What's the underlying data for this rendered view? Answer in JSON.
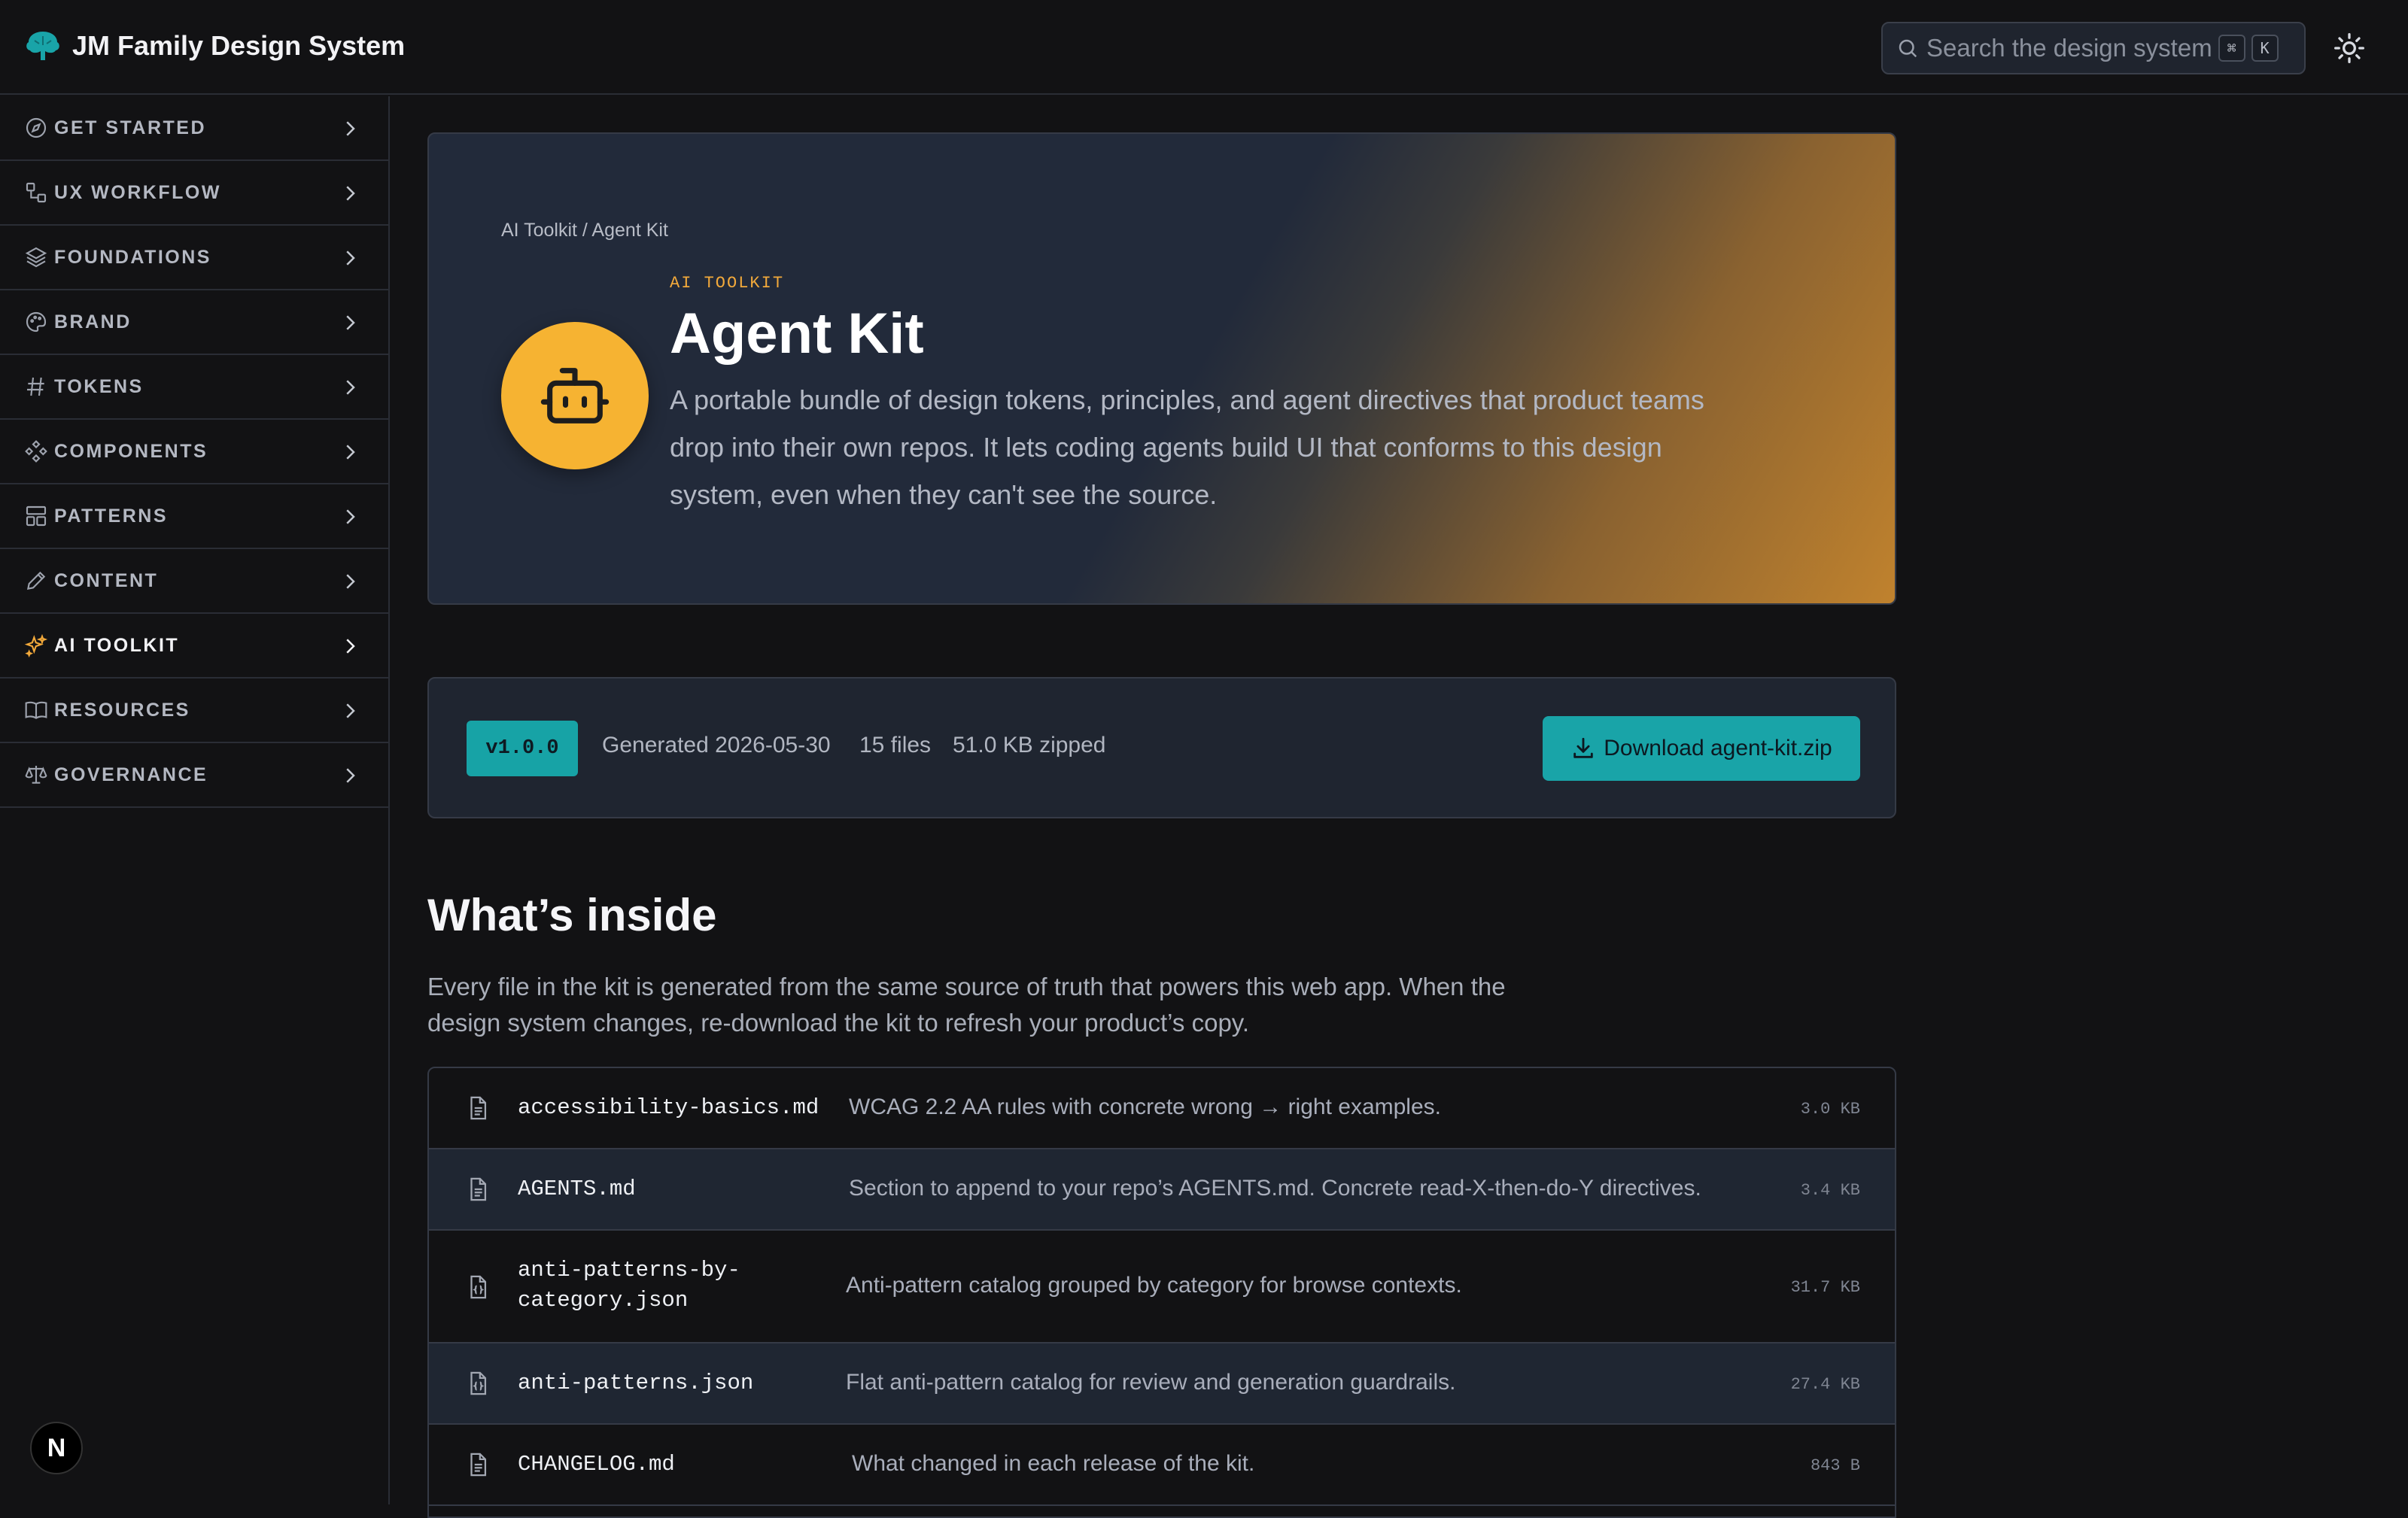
{
  "header": {
    "brand_name": "JM Family Design System",
    "search_placeholder": "Search the design system",
    "search_kbd_1": "⌘",
    "search_kbd_2": "K"
  },
  "sidebar": {
    "items": [
      {
        "label": "GET STARTED",
        "icon": "compass-icon"
      },
      {
        "label": "UX WORKFLOW",
        "icon": "workflow-icon"
      },
      {
        "label": "FOUNDATIONS",
        "icon": "layers-icon"
      },
      {
        "label": "BRAND",
        "icon": "palette-icon"
      },
      {
        "label": "TOKENS",
        "icon": "hash-icon"
      },
      {
        "label": "COMPONENTS",
        "icon": "components-icon"
      },
      {
        "label": "PATTERNS",
        "icon": "layout-icon"
      },
      {
        "label": "CONTENT",
        "icon": "pen-icon"
      },
      {
        "label": "AI TOOLKIT",
        "icon": "sparkles-icon",
        "active": true
      },
      {
        "label": "RESOURCES",
        "icon": "book-icon"
      },
      {
        "label": "GOVERNANCE",
        "icon": "scale-icon"
      }
    ],
    "badge": "N"
  },
  "hero": {
    "breadcrumb": "AI Toolkit / Agent Kit",
    "eyebrow": "AI TOOLKIT",
    "title": "Agent Kit",
    "description": "A portable bundle of design tokens, principles, and agent directives that product teams drop into their own repos. It lets coding agents build UI that conforms to this design system, even when they can't see the source."
  },
  "meta": {
    "version": "v1.0.0",
    "generated": "Generated 2026-05-30",
    "files": "15 files",
    "size": "51.0 KB zipped",
    "download_label": "Download agent-kit.zip"
  },
  "section": {
    "title": "What’s inside",
    "description": "Every file in the kit is generated from the same source of truth that powers this web app. When the design system changes, re-download the kit to refresh your product’s copy."
  },
  "files": [
    {
      "name": "accessibility-basics.md",
      "desc": "WCAG 2.2 AA rules with concrete wrong → right examples.",
      "size": "3.0 KB",
      "icon": "file-text-icon"
    },
    {
      "name": "AGENTS.md",
      "desc": "Section to append to your repo’s AGENTS.md. Concrete read-X-then-do-Y directives.",
      "size": "3.4 KB",
      "icon": "file-text-icon"
    },
    {
      "name_line1": "anti-patterns-by-",
      "name_line2": "category.json",
      "desc": "Anti-pattern catalog grouped by category for browse contexts.",
      "size": "31.7 KB",
      "icon": "file-json-icon"
    },
    {
      "name": "anti-patterns.json",
      "desc": "Flat anti-pattern catalog for review and generation guardrails.",
      "size": "27.4 KB",
      "icon": "file-json-icon"
    },
    {
      "name": "CHANGELOG.md",
      "desc": "What changed in each release of the kit.",
      "size": "843 B",
      "icon": "file-text-icon"
    }
  ],
  "colors": {
    "accent_teal": "#19a4a8",
    "accent_amber": "#f6b332",
    "background": "#121214"
  }
}
